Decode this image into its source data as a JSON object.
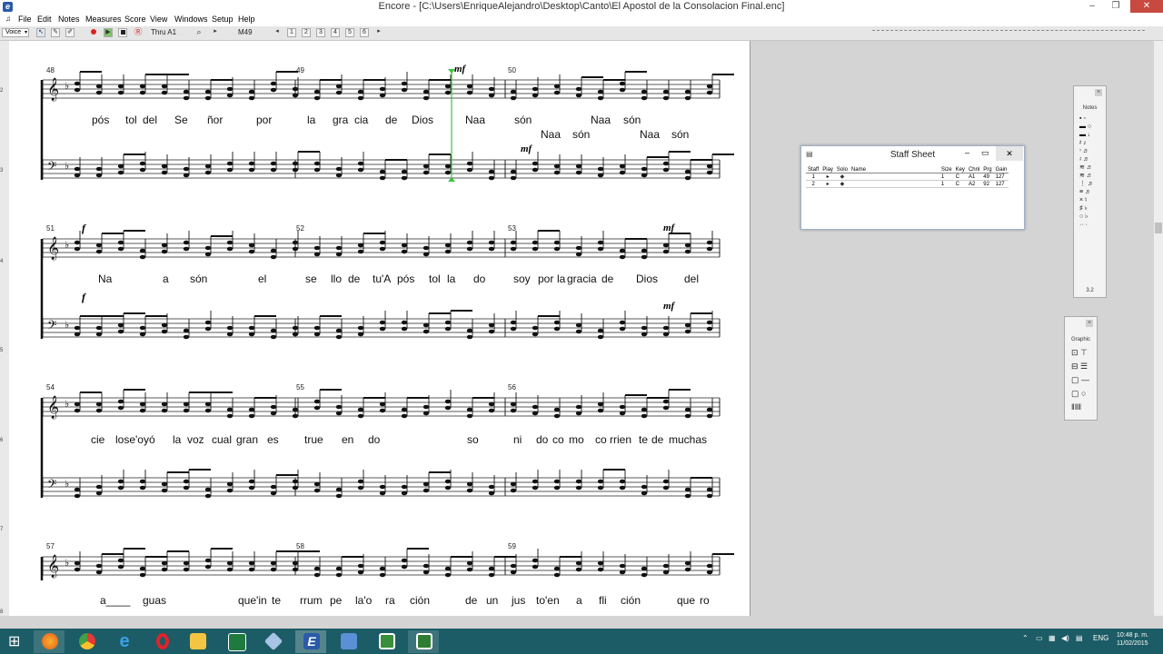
{
  "window": {
    "title": "Encore - [C:\\Users\\EnriqueAlejandro\\Desktop\\Canto\\El Apostol de la Consolacion Final.enc]",
    "app_icon": "encore-icon",
    "controls": {
      "minimize": "–",
      "maximize": "❐",
      "close": "✕"
    }
  },
  "menu": [
    "File",
    "Edit",
    "Notes",
    "Measures",
    "Score",
    "View",
    "Windows",
    "Setup",
    "Help"
  ],
  "toolbar": {
    "voice_label": "Voice",
    "thru_label": "Thru A1",
    "measure_label": "M49"
  },
  "score": {
    "systems": [
      {
        "measures": [
          "48",
          "49",
          "50"
        ],
        "upper_lyrics": [
          {
            "text": "pós"
          },
          {
            "text": "tol"
          },
          {
            "text": "del"
          },
          {
            "text": "Se"
          },
          {
            "text": "ñor"
          },
          {
            "text": "por"
          },
          {
            "text": "la"
          },
          {
            "text": "gra"
          },
          {
            "text": "cia"
          },
          {
            "text": "de"
          },
          {
            "text": "Dios"
          },
          {
            "text": "Naa"
          },
          {
            "text": "són"
          },
          {
            "text": "Naa"
          },
          {
            "text": "són"
          }
        ],
        "lower_lyrics": [
          {
            "text": "Naa"
          },
          {
            "text": "són"
          },
          {
            "text": "Naa"
          },
          {
            "text": "són"
          }
        ],
        "dynamics": [
          "mf",
          "mf"
        ]
      },
      {
        "measures": [
          "51",
          "52",
          "53"
        ],
        "upper_lyrics": [
          {
            "text": "Na"
          },
          {
            "text": "a"
          },
          {
            "text": "són"
          },
          {
            "text": "el"
          },
          {
            "text": "se"
          },
          {
            "text": "llo"
          },
          {
            "text": "de"
          },
          {
            "text": "tu'A"
          },
          {
            "text": "pós"
          },
          {
            "text": "tol"
          },
          {
            "text": "la"
          },
          {
            "text": "do"
          },
          {
            "text": "soy"
          },
          {
            "text": "por"
          },
          {
            "text": "la"
          },
          {
            "text": "gracia"
          },
          {
            "text": "de"
          },
          {
            "text": "Dios"
          },
          {
            "text": "del"
          }
        ],
        "dynamics": [
          "f",
          "f",
          "mf",
          "mf"
        ]
      },
      {
        "measures": [
          "54",
          "55",
          "56"
        ],
        "upper_lyrics": [
          {
            "text": "cie"
          },
          {
            "text": "lose'oyó"
          },
          {
            "text": "la"
          },
          {
            "text": "voz"
          },
          {
            "text": "cual"
          },
          {
            "text": "gran"
          },
          {
            "text": "es"
          },
          {
            "text": "true"
          },
          {
            "text": "en"
          },
          {
            "text": "do"
          },
          {
            "text": "so"
          },
          {
            "text": "ni"
          },
          {
            "text": "do"
          },
          {
            "text": "co"
          },
          {
            "text": "mo"
          },
          {
            "text": "co"
          },
          {
            "text": "rrien"
          },
          {
            "text": "te"
          },
          {
            "text": "de"
          },
          {
            "text": "muchas"
          }
        ]
      },
      {
        "measures": [
          "57",
          "58",
          "59"
        ],
        "upper_lyrics": [
          {
            "text": "a____"
          },
          {
            "text": "guas"
          },
          {
            "text": "que'in"
          },
          {
            "text": "te"
          },
          {
            "text": "rrum"
          },
          {
            "text": "pe"
          },
          {
            "text": "la'o"
          },
          {
            "text": "ra"
          },
          {
            "text": "ción"
          },
          {
            "text": "de"
          },
          {
            "text": "un"
          },
          {
            "text": "jus"
          },
          {
            "text": "to'en"
          },
          {
            "text": "a"
          },
          {
            "text": "fli"
          },
          {
            "text": "ción"
          },
          {
            "text": "que"
          },
          {
            "text": "ro"
          }
        ]
      }
    ],
    "ruler_marks": [
      "2",
      "3",
      "4",
      "5",
      "6",
      "7",
      "8"
    ]
  },
  "staff_sheet": {
    "title": "Staff Sheet",
    "columns": [
      "Staff",
      "Play",
      "Solo",
      "Name",
      "Size",
      "Key",
      "Chnl",
      "Prg",
      "Gain"
    ],
    "rows": [
      {
        "staff": "1",
        "play": "▸",
        "solo": "◆",
        "name": "",
        "size": "1",
        "key": "C",
        "chnl": "A1",
        "prg": "49",
        "gain": "127"
      },
      {
        "staff": "2",
        "play": "▸",
        "solo": "◆",
        "name": "",
        "size": "1",
        "key": "C",
        "chnl": "A2",
        "prg": "92",
        "gain": "127"
      }
    ]
  },
  "notes_palette": {
    "title": "Notes",
    "footer": "3.2"
  },
  "graphic_palette": {
    "title": "Graphic"
  },
  "taskbar": {
    "apps": [
      "windows-start-icon",
      "firefox-icon",
      "chrome-icon",
      "ie-icon",
      "opera-icon",
      "file-explorer-icon",
      "excel-icon",
      "3d-box-icon",
      "encore-icon",
      "remote-desktop-icon",
      "camtasia-icon",
      "camtasia-recorder-icon"
    ],
    "lang": "ENG",
    "time": "10:48 p. m.",
    "date": "11/02/2015"
  },
  "colors": {
    "taskbar": "#1c5c66",
    "close": "#c7493f",
    "playhead": "#3cc43c"
  }
}
